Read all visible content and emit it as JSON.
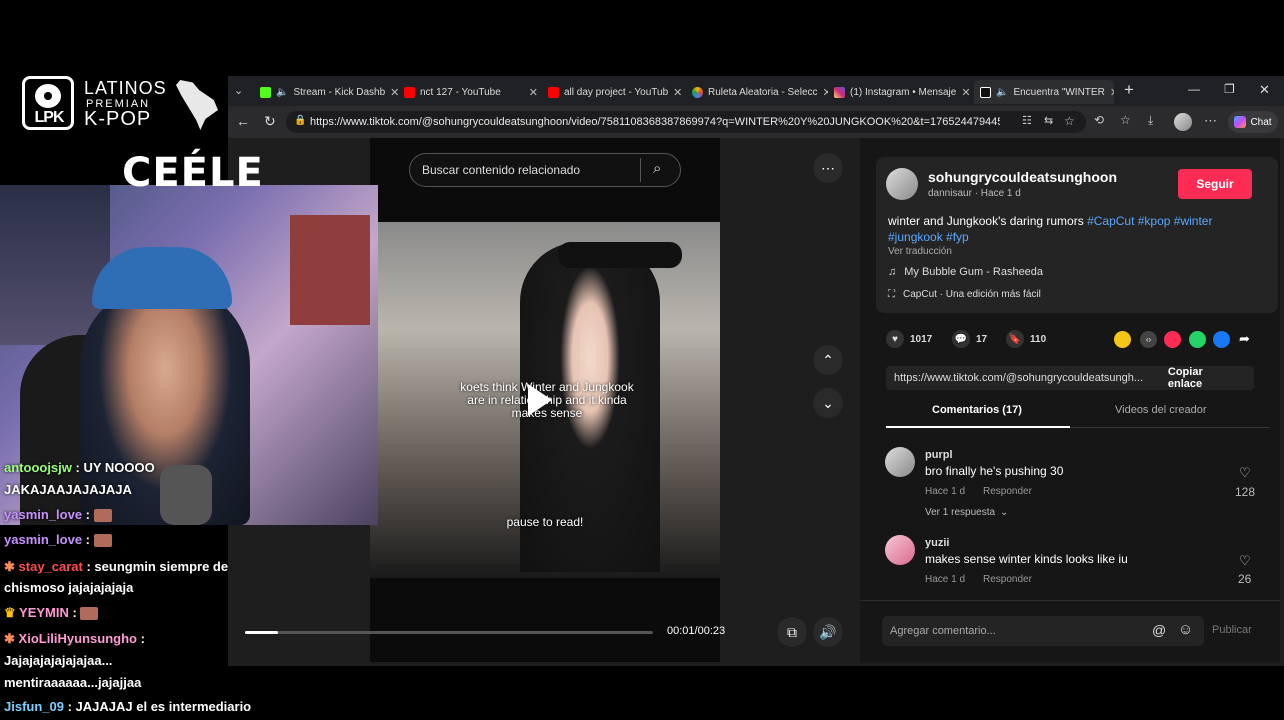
{
  "overlay": {
    "brand_line1": "LATINOS",
    "brand_line2": "PREMIAN",
    "brand_line3": "K-POP",
    "logo_text": "LPK",
    "streamer_name": "CEÉLE"
  },
  "browser": {
    "tabs": [
      {
        "label": "Stream - Kick Dashb",
        "icon": "kick-icon",
        "color": "#53fc18"
      },
      {
        "label": "nct 127 - YouTube",
        "icon": "youtube-icon",
        "color": "#ff0000"
      },
      {
        "label": "all day project - YouTub",
        "icon": "youtube-icon",
        "color": "#ff0000"
      },
      {
        "label": "Ruleta Aleatoria - Selecc",
        "icon": "wheel-icon",
        "color": "#f4b400"
      },
      {
        "label": "(1) Instagram • Mensaje",
        "icon": "instagram-icon",
        "color": "#e1306c"
      },
      {
        "label": "Encuentra \"WINTER",
        "icon": "tiktok-icon",
        "color": "#ffffff"
      }
    ],
    "new_tab": "+",
    "url": "https://www.tiktok.com/@sohungrycouldeatsunghoon/video/7581108368387869974?q=WINTER%20Y%20JUNGKOOK%20&t=1765244794458",
    "chat_label": "Chat"
  },
  "video": {
    "search_placeholder": "Buscar contenido relacionado",
    "caption_overlay": "koets think Winter and Jungkook are in relationship and it kinda makes sense",
    "pause_text": "pause to read!",
    "time": "00:01/00:23",
    "progress": 0.08
  },
  "post": {
    "username": "sohungrycouldeatsunghoon",
    "byline": "dannisaur · Hace 1 d",
    "follow_label": "Seguir",
    "description_text": "winter and Jungkook's daring rumors ",
    "hashtags_line1": "#CapCut #kpop #winter",
    "hashtags_line2": "#jungkook #fyp",
    "translate": "Ver traducción",
    "music": "My Bubble Gum - Rasheeda",
    "capcut": "CapCut · Una edición más fácil",
    "likes": "1017",
    "comments": "17",
    "saves": "110",
    "link": "https://www.tiktok.com/@sohungrycouldeatsungh...",
    "copy_label": "Copiar enlace",
    "tab_comments": "Comentarios (17)",
    "tab_videos": "Videos del creador"
  },
  "comments": [
    {
      "user": "purpl",
      "text": "bro finally he's pushing 30",
      "meta": "Hace 1 d",
      "reply": "Responder",
      "likes": "128",
      "replies_link": "Ver 1 respuesta"
    },
    {
      "user": "yuzii",
      "text": "makes sense winter kinds looks like iu",
      "meta": "Hace 1 d",
      "reply": "Responder",
      "likes": "26"
    }
  ],
  "comment_input": {
    "placeholder": "Agregar comentario...",
    "publish": "Publicar"
  },
  "chat": [
    {
      "user": "antooojsjw",
      "color": "#9aff7a",
      "text": ": UY NOOOO"
    },
    {
      "user": "",
      "color": "#ffffff",
      "text": "JAKAJAAJAJAJAJA"
    },
    {
      "user": "yasmin_love",
      "color": "#c792ff",
      "text": ":"
    },
    {
      "user": "yasmin_love",
      "color": "#c792ff",
      "text": ":"
    },
    {
      "user": "stay_carat",
      "color": "#ff4d4d",
      "text": ": seungmin siempre de"
    },
    {
      "user": "",
      "color": "#ffffff",
      "text": "chismoso jajajajajaja"
    },
    {
      "user": "YEYMIN",
      "color": "#ff9ad5",
      "text": ":"
    },
    {
      "user": "XioLiliHyunsungho",
      "color": "#ff9ad5",
      "text": ":"
    },
    {
      "user": "",
      "color": "#ffffff",
      "text": "Jajajajajajajajaa..."
    },
    {
      "user": "",
      "color": "#ffffff",
      "text": "mentiraaaaaa...jajajjaa"
    },
    {
      "user": "Jisfun_09",
      "color": "#7ad1ff",
      "text": ": JAJAJAJ el es intermediario"
    }
  ]
}
